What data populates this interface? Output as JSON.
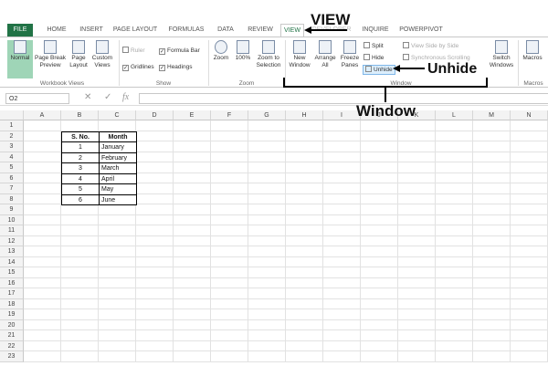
{
  "tabs": [
    "FILE",
    "HOME",
    "INSERT",
    "PAGE LAYOUT",
    "FORMULAS",
    "DATA",
    "REVIEW",
    "VIEW",
    "DEVELOPER",
    "INQUIRE",
    "POWERPIVOT"
  ],
  "ribbon": {
    "normal": "Normal",
    "page_break": "Page Break Preview",
    "page_layout": "Page Layout",
    "custom_views": "Custom Views",
    "ruler": "Ruler",
    "formula_bar": "Formula Bar",
    "gridlines": "Gridlines",
    "headings": "Headings",
    "zoom": "Zoom",
    "zoom100": "100%",
    "zoom_selection": "Zoom to Selection",
    "new_window": "New Window",
    "arrange_all": "Arrange All",
    "freeze_panes": "Freeze Panes",
    "split": "Split",
    "hide": "Hide",
    "unhide": "Unhide",
    "side_by_side": "View Side by Side",
    "sync_scroll": "Synchronous Scrolling",
    "switch_windows": "Switch Windows",
    "macros": "Macros",
    "groups": {
      "workbook_views": "Workbook Views",
      "show": "Show",
      "zoom": "Zoom",
      "window": "Window",
      "macros": "Macros"
    }
  },
  "name_box": "O2",
  "fx": "fx",
  "columns": [
    "A",
    "B",
    "C",
    "D",
    "E",
    "F",
    "G",
    "H",
    "I",
    "J",
    "K",
    "L",
    "M",
    "N"
  ],
  "rows": [
    "1",
    "2",
    "3",
    "4",
    "5",
    "6",
    "7",
    "8",
    "9",
    "10",
    "11",
    "12",
    "13",
    "14",
    "15",
    "16",
    "17",
    "18",
    "19",
    "20",
    "21",
    "22",
    "23"
  ],
  "table": {
    "headers": [
      "S. No.",
      "Month"
    ],
    "rows": [
      [
        "1",
        "January"
      ],
      [
        "2",
        "February"
      ],
      [
        "3",
        "March"
      ],
      [
        "4",
        "April"
      ],
      [
        "5",
        "May"
      ],
      [
        "6",
        "June"
      ]
    ]
  },
  "annotations": {
    "view": "VIEW",
    "unhide": "Unhide",
    "window": "Window"
  }
}
